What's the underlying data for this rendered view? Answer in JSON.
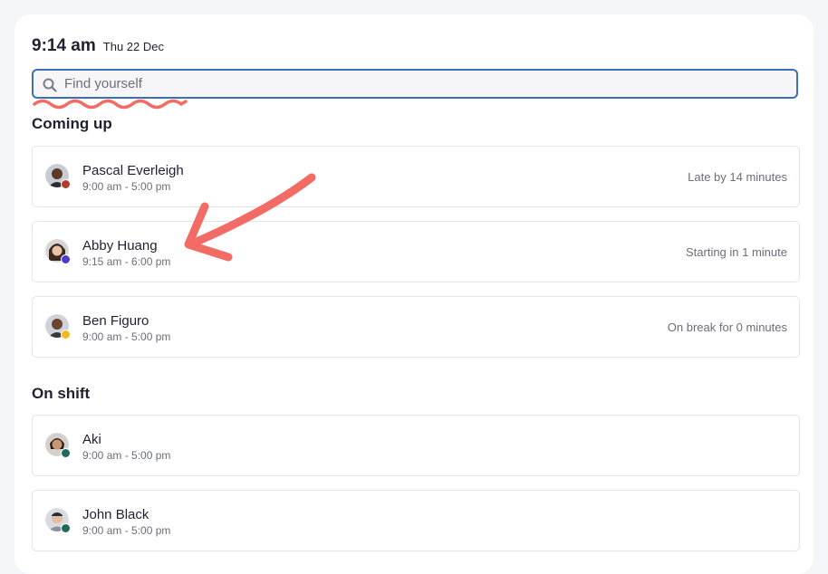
{
  "header": {
    "time": "9:14 am",
    "date": "Thu 22 Dec"
  },
  "search": {
    "placeholder": "Find yourself",
    "value": ""
  },
  "sections": {
    "coming_up": {
      "title": "Coming up",
      "people": [
        {
          "name": "Pascal Everleigh",
          "hours": "9:00 am - 5:00 pm",
          "status": "Late by 14 minutes",
          "dot_color": "#b33a2e"
        },
        {
          "name": "Abby Huang",
          "hours": "9:15 am - 6:00 pm",
          "status": "Starting in 1 minute",
          "dot_color": "#4b3bd1"
        },
        {
          "name": "Ben Figuro",
          "hours": "9:00 am - 5:00 pm",
          "status": "On break for 0 minutes",
          "dot_color": "#f2b81f"
        }
      ]
    },
    "on_shift": {
      "title": "On shift",
      "people": [
        {
          "name": "Aki",
          "hours": "9:00 am - 5:00 pm",
          "dot_color": "#1f6b5a"
        },
        {
          "name": "John Black",
          "hours": "9:00 am - 5:00 pm",
          "dot_color": "#1f6b5a"
        }
      ]
    }
  },
  "colors": {
    "accent": "#3e6fb6",
    "annotation": "#f26b64"
  },
  "icons": {
    "search": "search-icon",
    "annotation_arrow": "arrow-annotation",
    "annotation_squiggle": "squiggle-annotation"
  }
}
